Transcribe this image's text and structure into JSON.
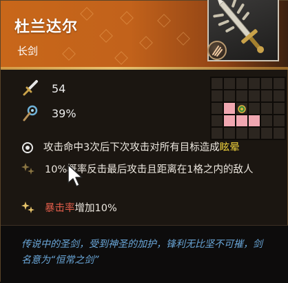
{
  "weapon": {
    "name": "杜兰达尔",
    "type": "长剑"
  },
  "stats": {
    "attack": "54",
    "crit": "39%"
  },
  "range_grid": {
    "cols": 6,
    "rows": 5,
    "highlighted_cells": [
      [
        2,
        1
      ],
      [
        3,
        1
      ],
      [
        3,
        2
      ],
      [
        3,
        3
      ]
    ],
    "player_cell": [
      2,
      2
    ]
  },
  "skills": {
    "s1_prefix": "攻击命中3次后下次攻击对所有目标造成",
    "s1_highlight": "眩晕",
    "s2_text": "10%概率反击最后攻击且距离在1格之内的敌人",
    "s3_highlight": "暴击率",
    "s3_suffix": "增加10%"
  },
  "lore": "传说中的圣剑，受到神圣的加护，锋利无比坚不可摧，剑名意为“恒常之剑”",
  "colors": {
    "header_orange": "#c8671a",
    "highlight_yellow": "#f1d23c",
    "highlight_red": "#e25d4a",
    "lore_blue": "#6aa7d9",
    "range_pink": "#f0a7b1"
  },
  "icons": {
    "attack": "sword-icon",
    "crit": "crit-staff-icon",
    "skill1": "target-ring-icon",
    "skill2": "star-sparkle-icon",
    "skill3": "star-sparkle-icon",
    "badge": "claw-slash-icon",
    "portrait": "holy-sword-icon"
  }
}
